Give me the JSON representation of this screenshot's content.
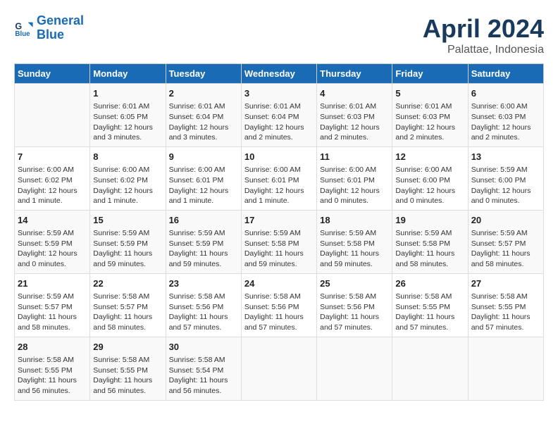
{
  "header": {
    "logo_line1": "General",
    "logo_line2": "Blue",
    "title": "April 2024",
    "subtitle": "Palattae, Indonesia"
  },
  "days_of_week": [
    "Sunday",
    "Monday",
    "Tuesday",
    "Wednesday",
    "Thursday",
    "Friday",
    "Saturday"
  ],
  "weeks": [
    [
      {
        "day": "",
        "info": ""
      },
      {
        "day": "1",
        "info": "Sunrise: 6:01 AM\nSunset: 6:05 PM\nDaylight: 12 hours\nand 3 minutes."
      },
      {
        "day": "2",
        "info": "Sunrise: 6:01 AM\nSunset: 6:04 PM\nDaylight: 12 hours\nand 3 minutes."
      },
      {
        "day": "3",
        "info": "Sunrise: 6:01 AM\nSunset: 6:04 PM\nDaylight: 12 hours\nand 2 minutes."
      },
      {
        "day": "4",
        "info": "Sunrise: 6:01 AM\nSunset: 6:03 PM\nDaylight: 12 hours\nand 2 minutes."
      },
      {
        "day": "5",
        "info": "Sunrise: 6:01 AM\nSunset: 6:03 PM\nDaylight: 12 hours\nand 2 minutes."
      },
      {
        "day": "6",
        "info": "Sunrise: 6:00 AM\nSunset: 6:03 PM\nDaylight: 12 hours\nand 2 minutes."
      }
    ],
    [
      {
        "day": "7",
        "info": "Sunrise: 6:00 AM\nSunset: 6:02 PM\nDaylight: 12 hours\nand 1 minute."
      },
      {
        "day": "8",
        "info": "Sunrise: 6:00 AM\nSunset: 6:02 PM\nDaylight: 12 hours\nand 1 minute."
      },
      {
        "day": "9",
        "info": "Sunrise: 6:00 AM\nSunset: 6:01 PM\nDaylight: 12 hours\nand 1 minute."
      },
      {
        "day": "10",
        "info": "Sunrise: 6:00 AM\nSunset: 6:01 PM\nDaylight: 12 hours\nand 1 minute."
      },
      {
        "day": "11",
        "info": "Sunrise: 6:00 AM\nSunset: 6:01 PM\nDaylight: 12 hours\nand 0 minutes."
      },
      {
        "day": "12",
        "info": "Sunrise: 6:00 AM\nSunset: 6:00 PM\nDaylight: 12 hours\nand 0 minutes."
      },
      {
        "day": "13",
        "info": "Sunrise: 5:59 AM\nSunset: 6:00 PM\nDaylight: 12 hours\nand 0 minutes."
      }
    ],
    [
      {
        "day": "14",
        "info": "Sunrise: 5:59 AM\nSunset: 5:59 PM\nDaylight: 12 hours\nand 0 minutes."
      },
      {
        "day": "15",
        "info": "Sunrise: 5:59 AM\nSunset: 5:59 PM\nDaylight: 11 hours\nand 59 minutes."
      },
      {
        "day": "16",
        "info": "Sunrise: 5:59 AM\nSunset: 5:59 PM\nDaylight: 11 hours\nand 59 minutes."
      },
      {
        "day": "17",
        "info": "Sunrise: 5:59 AM\nSunset: 5:58 PM\nDaylight: 11 hours\nand 59 minutes."
      },
      {
        "day": "18",
        "info": "Sunrise: 5:59 AM\nSunset: 5:58 PM\nDaylight: 11 hours\nand 59 minutes."
      },
      {
        "day": "19",
        "info": "Sunrise: 5:59 AM\nSunset: 5:58 PM\nDaylight: 11 hours\nand 58 minutes."
      },
      {
        "day": "20",
        "info": "Sunrise: 5:59 AM\nSunset: 5:57 PM\nDaylight: 11 hours\nand 58 minutes."
      }
    ],
    [
      {
        "day": "21",
        "info": "Sunrise: 5:59 AM\nSunset: 5:57 PM\nDaylight: 11 hours\nand 58 minutes."
      },
      {
        "day": "22",
        "info": "Sunrise: 5:58 AM\nSunset: 5:57 PM\nDaylight: 11 hours\nand 58 minutes."
      },
      {
        "day": "23",
        "info": "Sunrise: 5:58 AM\nSunset: 5:56 PM\nDaylight: 11 hours\nand 57 minutes."
      },
      {
        "day": "24",
        "info": "Sunrise: 5:58 AM\nSunset: 5:56 PM\nDaylight: 11 hours\nand 57 minutes."
      },
      {
        "day": "25",
        "info": "Sunrise: 5:58 AM\nSunset: 5:56 PM\nDaylight: 11 hours\nand 57 minutes."
      },
      {
        "day": "26",
        "info": "Sunrise: 5:58 AM\nSunset: 5:55 PM\nDaylight: 11 hours\nand 57 minutes."
      },
      {
        "day": "27",
        "info": "Sunrise: 5:58 AM\nSunset: 5:55 PM\nDaylight: 11 hours\nand 57 minutes."
      }
    ],
    [
      {
        "day": "28",
        "info": "Sunrise: 5:58 AM\nSunset: 5:55 PM\nDaylight: 11 hours\nand 56 minutes."
      },
      {
        "day": "29",
        "info": "Sunrise: 5:58 AM\nSunset: 5:55 PM\nDaylight: 11 hours\nand 56 minutes."
      },
      {
        "day": "30",
        "info": "Sunrise: 5:58 AM\nSunset: 5:54 PM\nDaylight: 11 hours\nand 56 minutes."
      },
      {
        "day": "",
        "info": ""
      },
      {
        "day": "",
        "info": ""
      },
      {
        "day": "",
        "info": ""
      },
      {
        "day": "",
        "info": ""
      }
    ]
  ]
}
